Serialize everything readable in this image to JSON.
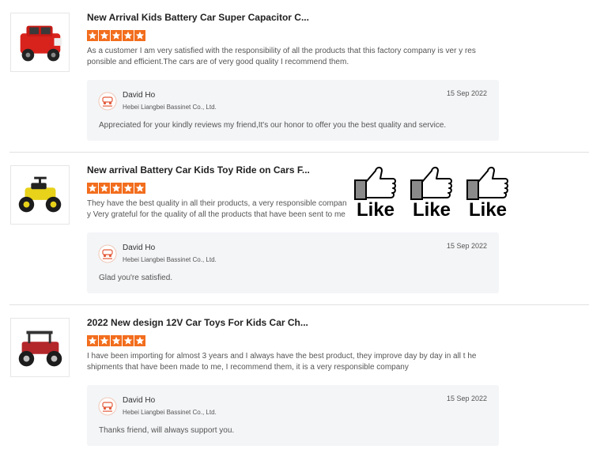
{
  "colors": {
    "star": "#f26d1d",
    "reply_bg": "#f4f5f7"
  },
  "reviews": [
    {
      "product_icon": "red-ride-on-car-image",
      "title": "New Arrival Kids Battery Car Super Capacitor C...",
      "rating": 5,
      "text": "As a customer I am very satisfied with the responsibility of all the products that this factory company is ver y responsible and efficient.The cars are of very good quality I recommend them.",
      "reply": {
        "name": "David Ho",
        "company": "Hebei Liangbei Bassinet Co., Ltd.",
        "date": "15 Sep 2022",
        "text": "Appreciated for your kindly reviews my friend,It's our honor to offer you the best quality and service."
      }
    },
    {
      "product_icon": "yellow-atv-image",
      "title": "New arrival Battery Car Kids Toy Ride on Cars F...",
      "rating": 5,
      "text": "They have the best quality in all their products, a very responsible company Very grateful for the quality of all the products that have been sent to me",
      "reply": {
        "name": "David Ho",
        "company": "Hebei Liangbei Bassinet Co., Ltd.",
        "date": "15 Sep 2022",
        "text": "Glad you're satisfied."
      }
    },
    {
      "product_icon": "red-utv-image",
      "title": "2022 New design 12V Car Toys For Kids Car Ch...",
      "rating": 5,
      "text": "I have been importing for almost 3 years and I always have the best product, they improve day by day in all t he shipments that have been made to me, I recommend them, it is a very responsible company",
      "reply": {
        "name": "David Ho",
        "company": "Hebei Liangbei Bassinet Co., Ltd.",
        "date": "15 Sep 2022",
        "text": "Thanks friend, will always support you."
      }
    }
  ],
  "likes": [
    "Like",
    "Like",
    "Like"
  ]
}
